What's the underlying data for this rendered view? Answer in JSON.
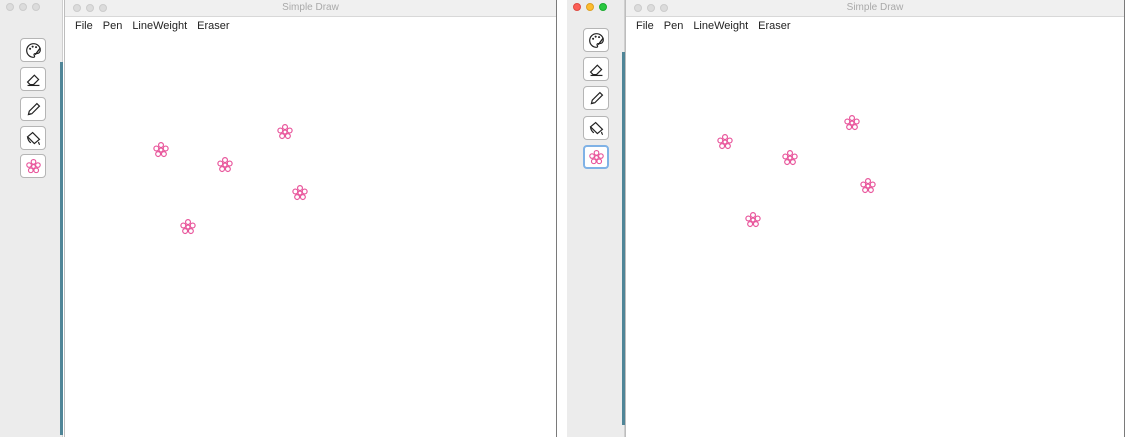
{
  "app": {
    "window_title": "Simple Draw",
    "menus": [
      "File",
      "Pen",
      "LineWeight",
      "Eraser"
    ]
  },
  "tools": [
    {
      "name": "palette-icon",
      "selected": false
    },
    {
      "name": "eraser-icon",
      "selected": false
    },
    {
      "name": "pencil-icon",
      "selected": false
    },
    {
      "name": "paint-bucket-icon",
      "selected": false
    },
    {
      "name": "flower-stamp-icon",
      "selected": true
    }
  ],
  "colors": {
    "stamp": "#e8539a",
    "selection_border": "#7fb2e6",
    "palette_edge": "#4f8597"
  },
  "stamps": {
    "count": 5,
    "icon": "flower-stamp-icon"
  }
}
